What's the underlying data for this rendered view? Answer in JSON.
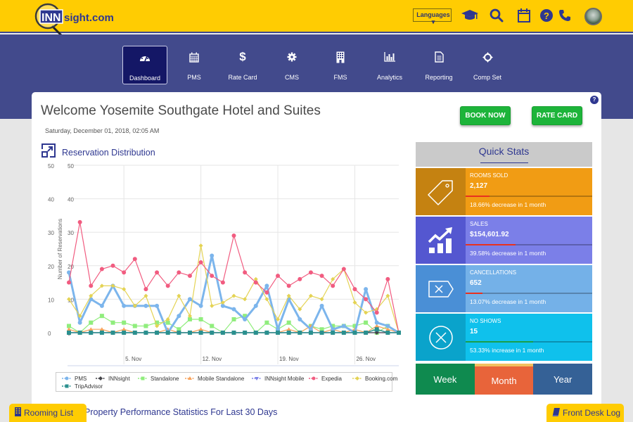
{
  "header": {
    "logo_text": "INNsight.com",
    "logo_box": "INN",
    "logo_rest": "sight.com",
    "languages_label": "Languages",
    "icons": [
      "graduation-cap-icon",
      "search-icon",
      "calendar-icon",
      "help-circle-icon",
      "phone-icon"
    ],
    "colors": {
      "bar": "#ffcc02",
      "icon": "#2e3790"
    }
  },
  "nav": {
    "items": [
      {
        "label": "Dashboard",
        "icon": "dashboard-icon",
        "active": true
      },
      {
        "label": "PMS",
        "icon": "calendar-grid-icon",
        "active": false
      },
      {
        "label": "Rate Card",
        "icon": "dollar-icon",
        "active": false
      },
      {
        "label": "CMS",
        "icon": "gear-icon",
        "active": false
      },
      {
        "label": "FMS",
        "icon": "building-icon",
        "active": false
      },
      {
        "label": "Analytics",
        "icon": "bar-chart-icon",
        "active": false
      },
      {
        "label": "Reporting",
        "icon": "document-icon",
        "active": false
      },
      {
        "label": "Comp Set",
        "icon": "crosshair-icon",
        "active": false
      }
    ]
  },
  "main": {
    "welcome": "Welcome Yosemite Southgate Hotel and Suites",
    "datetime": "Saturday, December 01, 2018, 02:05 AM",
    "help_label": "?",
    "book_now_label": "BOOK NOW",
    "rate_card_label": "RATE CARD",
    "reservation_title": "Reservation Distribution",
    "performance_title": "Property Performance Statistics For Last 30 Days"
  },
  "quick_stats": {
    "title": "Quick Stats",
    "items": [
      {
        "label": "ROOMS SOLD",
        "value": "2,127",
        "note": "18.66% decrease in 1 month",
        "progress_pct": 18.66,
        "bar_color": "#e8311e",
        "icon": "price-tag-icon",
        "color": "#f19c14",
        "icon_bg": "#c58211"
      },
      {
        "label": "SALES",
        "value": "$154,601.92",
        "note": "39.58% decrease in 1 month",
        "progress_pct": 39.58,
        "bar_color": "#e8311e",
        "icon": "growth-chart-icon",
        "color": "#7b7fe8",
        "icon_bg": "#5457d0"
      },
      {
        "label": "CANCELLATIONS",
        "value": "652",
        "note": "13.07% decrease in 1 month",
        "progress_pct": 13.07,
        "bar_color": "#e8311e",
        "icon": "cancel-tag-icon",
        "color": "#74b1e8",
        "icon_bg": "#4a8fd6"
      },
      {
        "label": "NO SHOWS",
        "value": "15",
        "note": "53.33% increase in 1 month",
        "progress_pct": 53.33,
        "bar_color": "#1a9e4a",
        "icon": "x-circle-icon",
        "color": "#0fc1ec",
        "icon_bg": "#0aa3cb"
      }
    ],
    "periods": [
      {
        "label": "Week",
        "color": "#0f8a4f",
        "active": false
      },
      {
        "label": "Month",
        "color": "#e8643a",
        "active": true,
        "accent": "#f2c05e"
      },
      {
        "label": "Year",
        "color": "#356196",
        "active": false
      }
    ]
  },
  "floating": {
    "rooming_list_label": "Rooming List",
    "front_desk_log_label": "Front Desk Log"
  },
  "chart_data": {
    "type": "line",
    "title": "Reservation Distribution",
    "xlabel": "",
    "ylabel": "Number of Reservations",
    "ylim": [
      0,
      50
    ],
    "yticks": [
      0,
      10,
      20,
      30,
      40,
      50
    ],
    "x_start": "31 Oct",
    "x_tick_labels": [
      "5. Nov",
      "12. Nov",
      "19. Nov",
      "26. Nov"
    ],
    "x_tick_indices": [
      5,
      12,
      19,
      26
    ],
    "grid": true,
    "legend_position": "bottom",
    "series": [
      {
        "name": "PMS",
        "color": "#7cb5ec",
        "marker": "circle",
        "width": 3,
        "values": [
          18,
          3,
          10,
          8,
          14,
          8,
          8,
          8,
          8,
          0,
          5,
          10,
          8,
          23,
          8,
          7,
          4,
          8,
          14,
          1,
          10,
          4,
          1,
          8,
          1,
          2,
          0,
          13,
          3,
          2,
          0
        ]
      },
      {
        "name": "INNsight",
        "color": "#434348",
        "marker": "diamond",
        "width": 1.2,
        "values": [
          0,
          0,
          0,
          0,
          0,
          0,
          0,
          0,
          0,
          0,
          0,
          0,
          0,
          0,
          0,
          0,
          0,
          0,
          0,
          0,
          0,
          0,
          0,
          0,
          0,
          0,
          0,
          0,
          0,
          0,
          0
        ]
      },
      {
        "name": "Standalone",
        "color": "#90ed7d",
        "marker": "square",
        "width": 1.2,
        "values": [
          2,
          0,
          3,
          5,
          3,
          3,
          2,
          2,
          3,
          3,
          1,
          4,
          4,
          2,
          0,
          4,
          5,
          0,
          3,
          1,
          3,
          0,
          2,
          1,
          2,
          2,
          2,
          3,
          0,
          2,
          0
        ]
      },
      {
        "name": "Mobile Standalone",
        "color": "#f7a35c",
        "marker": "triangle",
        "width": 1.2,
        "values": [
          1,
          0,
          1,
          1,
          0,
          1,
          0,
          0,
          0,
          1,
          0,
          0,
          1,
          0,
          0,
          0,
          0,
          0,
          0,
          0,
          1,
          0,
          2,
          0,
          1,
          0,
          1,
          0,
          2,
          1,
          0
        ]
      },
      {
        "name": "INNsight Mobile",
        "color": "#8085e9",
        "marker": "triangle-down",
        "width": 1.2,
        "values": [
          0,
          0,
          0,
          0,
          0,
          0,
          0,
          0,
          0,
          0,
          0,
          0,
          0,
          0,
          0,
          0,
          0,
          0,
          0,
          0,
          0,
          0,
          0,
          0,
          0,
          0,
          0,
          0,
          0,
          0,
          0
        ]
      },
      {
        "name": "Expedia",
        "color": "#f15c80",
        "marker": "circle",
        "width": 1.2,
        "values": [
          15,
          33,
          14,
          19,
          20,
          18,
          22,
          13,
          18,
          14,
          18,
          17,
          21,
          17,
          15,
          29,
          18,
          15,
          12,
          17,
          14,
          16,
          18,
          17,
          14,
          19,
          13,
          10,
          6,
          16,
          0
        ]
      },
      {
        "name": "Booking.com",
        "color": "#e4d354",
        "marker": "diamond",
        "width": 1.2,
        "values": [
          10,
          5,
          11,
          14,
          14,
          13,
          8,
          11,
          2,
          4,
          11,
          5,
          26,
          8,
          9,
          11,
          10,
          16,
          10,
          4,
          11,
          7,
          11,
          10,
          16,
          19,
          9,
          6,
          7,
          11,
          0
        ]
      },
      {
        "name": "TripAdvisor",
        "color": "#2b908f",
        "marker": "square",
        "width": 1.5,
        "values": [
          0,
          0,
          0,
          0,
          0,
          0,
          0,
          0,
          0,
          0,
          0,
          0,
          0,
          0,
          0,
          0,
          0,
          0,
          0,
          0,
          0,
          0,
          0,
          0,
          0,
          0,
          0,
          0,
          1,
          0,
          0
        ]
      }
    ]
  }
}
